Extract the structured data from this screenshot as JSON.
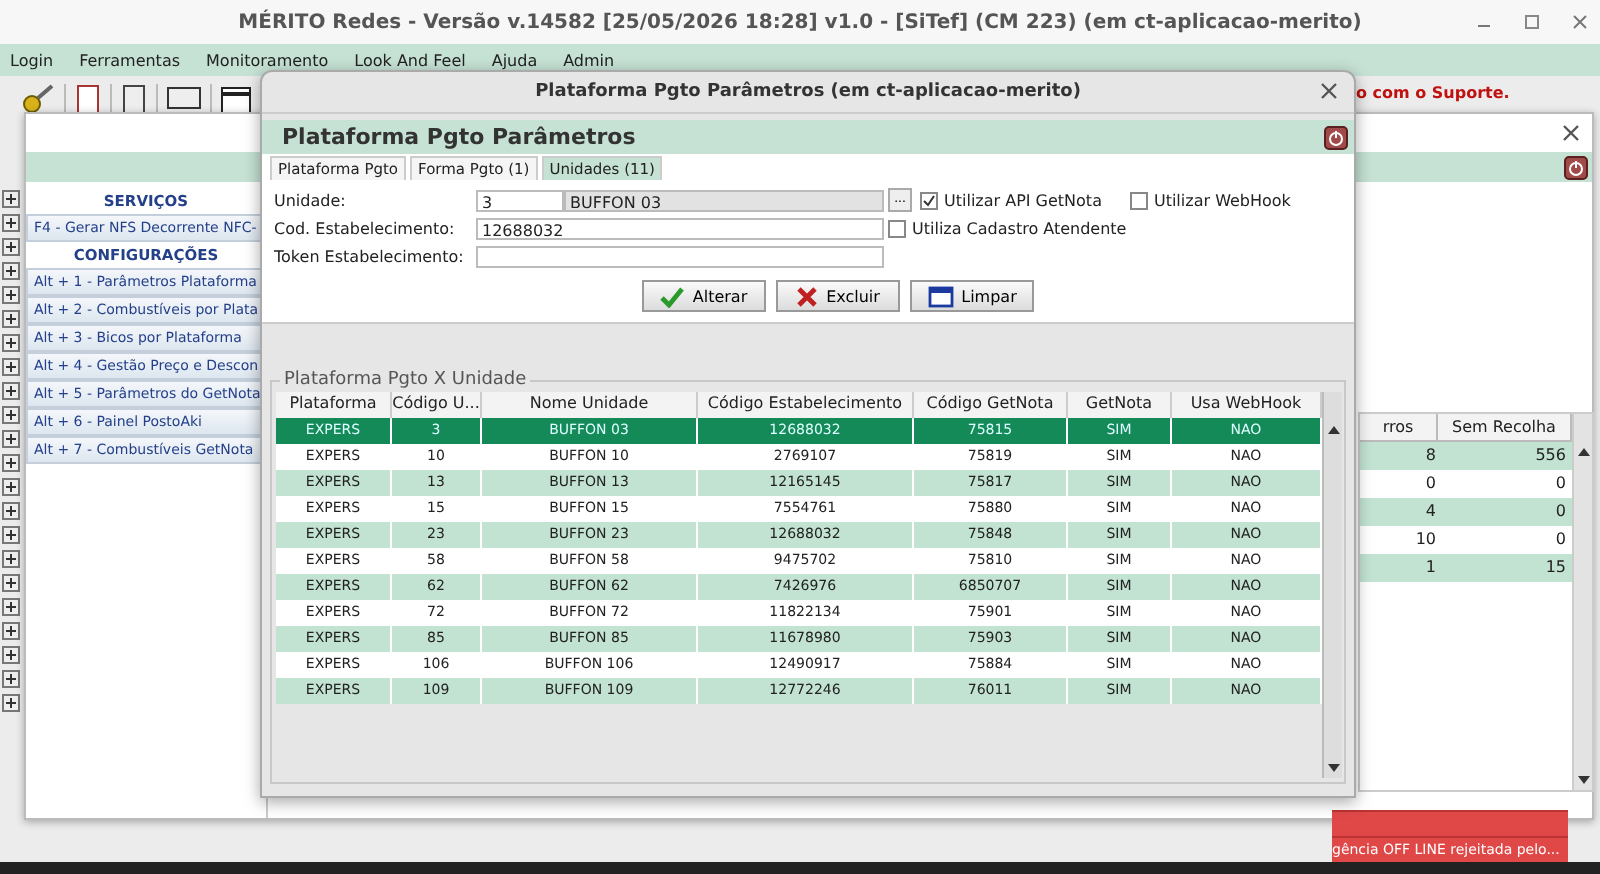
{
  "app": {
    "title": "MÉRITO Redes - Versão v.14582 [25/05/2026 18:28] v1.0 - [SiTef] (CM 223) (em ct-aplicacao-merito)"
  },
  "menu": [
    "Login",
    "Ferramentas",
    "Monitoramento",
    "Look And Feel",
    "Ajuda",
    "Admin"
  ],
  "notice": "o com o Suporte.",
  "sidebar": [
    {
      "title": "SERVIÇOS",
      "items": [
        "F4 - Gerar NFS Decorrente NFC-"
      ]
    },
    {
      "title": "CONFIGURAÇÕES",
      "items": [
        "Alt + 1 - Parâmetros Plataforma",
        "Alt + 2 - Combustíveis por Plata",
        "Alt + 3 - Bicos por Plataforma",
        "Alt + 4 - Gestão Preço e Descon",
        "Alt + 5 - Parâmetros do GetNota",
        "Alt + 6 - Painel PostoAki",
        "Alt + 7 - Combustíveis GetNota"
      ]
    }
  ],
  "background_table": {
    "columns": [
      "rros",
      "Sem Recolha"
    ],
    "rows": [
      [
        "8",
        "556"
      ],
      [
        "0",
        "0"
      ],
      [
        "4",
        "0"
      ],
      [
        "10",
        "0"
      ],
      [
        "1",
        "15"
      ]
    ]
  },
  "alerts": [
    "gência OFF LINE rejeitada  pelo..."
  ],
  "dialog": {
    "title": "Plataforma Pgto Parâmetros (em ct-aplicacao-merito)",
    "header": "Plataforma Pgto Parâmetros",
    "tabs": [
      {
        "label": "Plataforma Pgto",
        "selected": false
      },
      {
        "label": "Forma Pgto (1)",
        "selected": false
      },
      {
        "label": "Unidades (11)",
        "selected": true
      }
    ],
    "unidade": {
      "label": "Unidade:",
      "value": "3",
      "name": "BUFFON 03",
      "lookup": "..."
    },
    "cod_estabelecimento": {
      "label": "Cod. Estabelecimento:",
      "value": "12688032"
    },
    "token": {
      "label": "Token Estabelecimento:"
    },
    "checkboxes": [
      {
        "label": "Utilizar API GetNota",
        "checked": true
      },
      {
        "label": "Utilizar WebHook",
        "checked": false
      },
      {
        "label": "Utiliza Cadastro Atendente",
        "checked": false
      }
    ],
    "buttons": [
      {
        "label": "Alterar",
        "kind": "confirm"
      },
      {
        "label": "Excluir",
        "kind": "delete"
      },
      {
        "label": "Limpar",
        "kind": "clear"
      }
    ],
    "group_title": "Plataforma Pgto X Unidade",
    "table": {
      "columns": [
        "Plataforma",
        "Código U...",
        "Nome Unidade",
        "Código Estabelecimento",
        "Código GetNota",
        "GetNota",
        "Usa WebHook"
      ],
      "rows": [
        {
          "cells": [
            "EXPERS",
            "3",
            "BUFFON 03",
            "12688032",
            "75815",
            "SIM",
            "NAO"
          ],
          "selected": true
        },
        {
          "cells": [
            "EXPERS",
            "10",
            "BUFFON 10",
            "2769107",
            "75819",
            "SIM",
            "NAO"
          ],
          "selected": false
        },
        {
          "cells": [
            "EXPERS",
            "13",
            "BUFFON 13",
            "12165145",
            "75817",
            "SIM",
            "NAO"
          ],
          "selected": false
        },
        {
          "cells": [
            "EXPERS",
            "15",
            "BUFFON 15",
            "7554761",
            "75880",
            "SIM",
            "NAO"
          ],
          "selected": false
        },
        {
          "cells": [
            "EXPERS",
            "23",
            "BUFFON 23",
            "12688032",
            "75848",
            "SIM",
            "NAO"
          ],
          "selected": false
        },
        {
          "cells": [
            "EXPERS",
            "58",
            "BUFFON 58",
            "9475702",
            "75810",
            "SIM",
            "NAO"
          ],
          "selected": false
        },
        {
          "cells": [
            "EXPERS",
            "62",
            "BUFFON 62",
            "7426976",
            "6850707",
            "SIM",
            "NAO"
          ],
          "selected": false
        },
        {
          "cells": [
            "EXPERS",
            "72",
            "BUFFON 72",
            "11822134",
            "75901",
            "SIM",
            "NAO"
          ],
          "selected": false
        },
        {
          "cells": [
            "EXPERS",
            "85",
            "BUFFON 85",
            "11678980",
            "75903",
            "SIM",
            "NAO"
          ],
          "selected": false
        },
        {
          "cells": [
            "EXPERS",
            "106",
            "BUFFON 106",
            "12490917",
            "75884",
            "SIM",
            "NAO"
          ],
          "selected": false
        },
        {
          "cells": [
            "EXPERS",
            "109",
            "BUFFON 109",
            "12772246",
            "76011",
            "SIM",
            "NAO"
          ],
          "selected": false
        }
      ]
    }
  }
}
